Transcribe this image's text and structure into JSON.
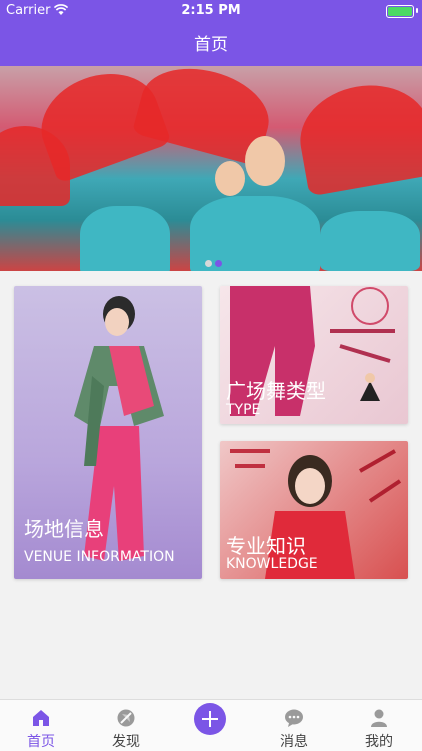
{
  "status_bar": {
    "carrier": "Carrier",
    "time": "2:15 PM"
  },
  "nav": {
    "title": "首页"
  },
  "banner": {
    "page_count": 2,
    "active_index": 1
  },
  "cards": {
    "venue": {
      "title_cn": "场地信息",
      "title_en": "VENUE INFORMATION"
    },
    "type": {
      "title_cn": "广场舞类型",
      "title_en": "TYPE"
    },
    "knowledge": {
      "title_cn": "专业知识",
      "title_en": "KNOWLEDGE"
    }
  },
  "tabbar": {
    "home": "首页",
    "discover": "发现",
    "messages": "消息",
    "mine": "我的"
  },
  "colors": {
    "accent": "#7b55e6",
    "battery": "#4cd964"
  }
}
